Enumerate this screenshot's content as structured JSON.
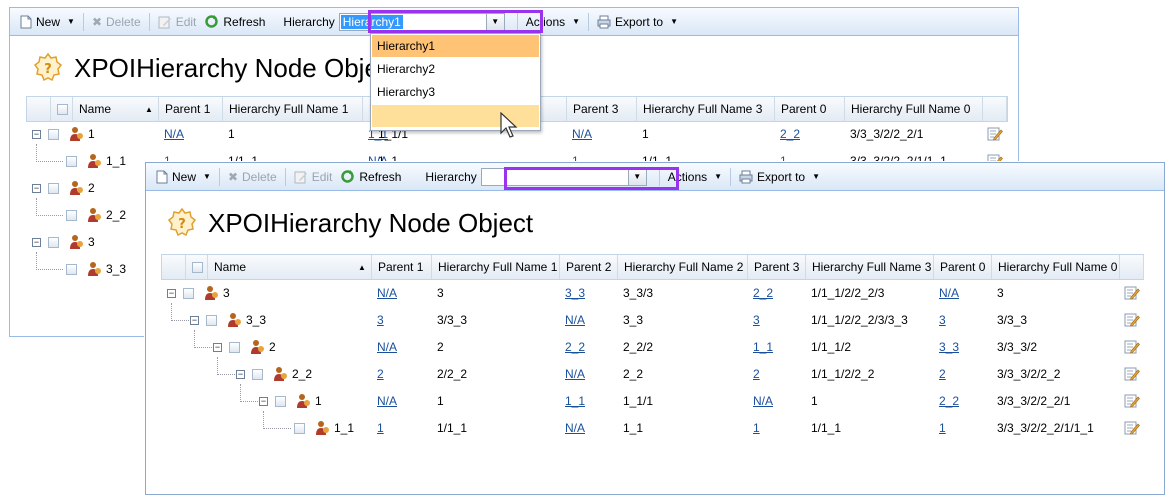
{
  "toolbar": {
    "new": "New",
    "delete": "Delete",
    "edit": "Edit",
    "refresh": "Refresh",
    "hierarchy_label": "Hierarchy",
    "actions": "Actions",
    "export": "Export to"
  },
  "back": {
    "combo_value": "Hierarchy1",
    "dropdown_options": [
      "Hierarchy1",
      "Hierarchy2",
      "Hierarchy3",
      ""
    ],
    "title": "XPOIHierarchy Node Objec",
    "columns": [
      "Name",
      "Parent 1",
      "Hierarchy Full Name 1",
      "P",
      "e 2",
      "Parent 3",
      "Hierarchy Full Name 3",
      "Parent 0",
      "Hierarchy Full Name 0"
    ],
    "rows": [
      {
        "name": "1",
        "p1": "N/A",
        "h1": "1",
        "p2": "1_1",
        "h2": "1_1/1",
        "p3": "N/A",
        "h3": "1",
        "p0": "2_2",
        "h0": "3/3_3/2/2_2/1"
      },
      {
        "name": "1_1",
        "p1": "1",
        "h1": "1/1_1",
        "p2": "N/A",
        "h2": "1_1",
        "p3": "1",
        "h3": "1/1_1",
        "p0": "1",
        "h0": "3/3_3/2/2_2/1/1_1"
      },
      {
        "name": "2"
      },
      {
        "name": "2_2"
      },
      {
        "name": "3"
      },
      {
        "name": "3_3"
      }
    ]
  },
  "front": {
    "combo_value": "",
    "title": "XPOIHierarchy Node Object",
    "columns": [
      "Name",
      "Parent 1",
      "Hierarchy Full Name 1",
      "Parent 2",
      "Hierarchy Full Name 2",
      "Parent 3",
      "Hierarchy Full Name 3",
      "Parent 0",
      "Hierarchy Full Name 0"
    ],
    "rows": [
      {
        "name": "3",
        "p1": "N/A",
        "h1": "3",
        "p2": "3_3",
        "h2": "3_3/3",
        "p3": "2_2",
        "h3": "1/1_1/2/2_2/3",
        "p0": "N/A",
        "h0": "3"
      },
      {
        "name": "3_3",
        "p1": "3",
        "h1": "3/3_3",
        "p2": "N/A",
        "h2": "3_3",
        "p3": "3",
        "h3": "1/1_1/2/2_2/3/3_3",
        "p0": "3",
        "h0": "3/3_3"
      },
      {
        "name": "2",
        "p1": "N/A",
        "h1": "2",
        "p2": "2_2",
        "h2": "2_2/2",
        "p3": "1_1",
        "h3": "1/1_1/2",
        "p0": "3_3",
        "h0": "3/3_3/2"
      },
      {
        "name": "2_2",
        "p1": "2",
        "h1": "2/2_2",
        "p2": "N/A",
        "h2": "2_2",
        "p3": "2",
        "h3": "1/1_1/2/2_2",
        "p0": "2",
        "h0": "3/3_3/2/2_2"
      },
      {
        "name": "1",
        "p1": "N/A",
        "h1": "1",
        "p2": "1_1",
        "h2": "1_1/1",
        "p3": "N/A",
        "h3": "1",
        "p0": "2_2",
        "h0": "3/3_3/2/2_2/1"
      },
      {
        "name": "1_1",
        "p1": "1",
        "h1": "1/1_1",
        "p2": "N/A",
        "h2": "1_1",
        "p3": "1",
        "h3": "1/1_1",
        "p0": "1",
        "h0": "3/3_3/2/2_2/1/1_1"
      }
    ]
  }
}
